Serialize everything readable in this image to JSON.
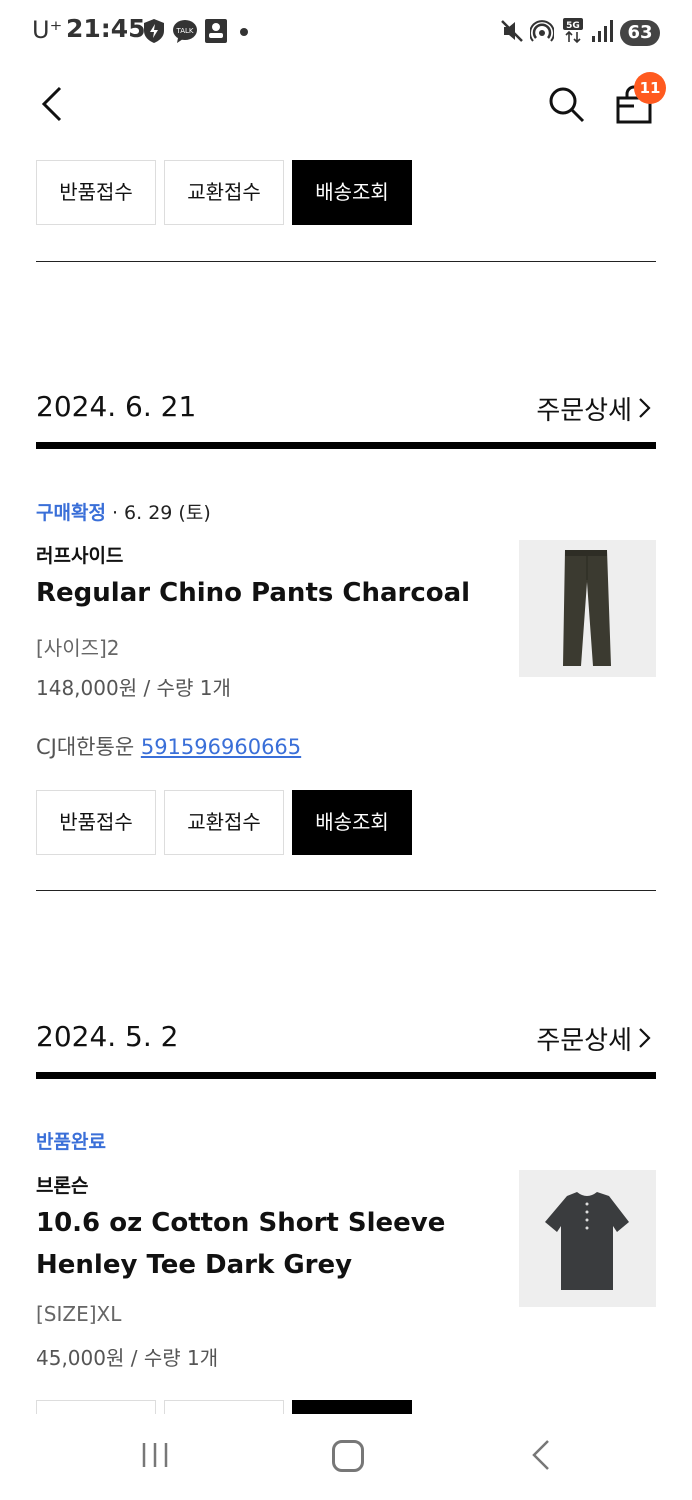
{
  "statusbar": {
    "carrier": "U⁺",
    "time": "21:45",
    "battery": "63"
  },
  "header": {
    "cart_count": "11"
  },
  "buttons": {
    "return": "반품접수",
    "exchange": "교환접수",
    "tracking": "배송조회"
  },
  "orders": [
    {
      "date": "2024. 6. 21",
      "detail_label": "주문상세",
      "status": "구매확정",
      "status_date": " · 6. 29 (토)",
      "brand": "러프사이드",
      "product_name": "Regular Chino Pants Charcoal",
      "option": "[사이즈]2",
      "price_qty": "148,000원 / 수량 1개",
      "courier": "CJ대한통운",
      "tracking_no": "591596960665"
    },
    {
      "date": "2024. 5. 2",
      "detail_label": "주문상세",
      "status": "반품완료",
      "brand": "브론슨",
      "product_name": "10.6 oz Cotton Short Sleeve Henley Tee Dark Grey",
      "option": "[SIZE]XL",
      "price_qty": "45,000원 / 수량 1개"
    }
  ],
  "colors": {
    "accent_blue": "#3a6fd8",
    "badge_orange": "#ff5a1f"
  },
  "icons": [
    "back-icon",
    "search-icon",
    "shopping-bag-icon",
    "chevron-right-icon",
    "recent-apps-icon",
    "home-icon",
    "nav-back-icon"
  ]
}
